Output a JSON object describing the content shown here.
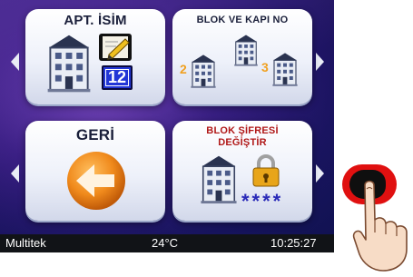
{
  "tiles": {
    "apt_name": {
      "title": "APT. İSİM",
      "badge_number": "12"
    },
    "block_door": {
      "title": "BLOK VE KAPI NO",
      "num_left": "2",
      "num_right": "3"
    },
    "back": {
      "title": "GERİ"
    },
    "block_password": {
      "title_line1": "BLOK ŞİFRESİ",
      "title_line2": "DEĞİŞTİR",
      "mask": "****"
    }
  },
  "status_bar": {
    "brand": "Multitek",
    "temperature": "24°C",
    "time": "10:25:27"
  },
  "icons": [
    "building-icon",
    "edit-pencil-icon",
    "number-badge-icon",
    "back-arrow-icon",
    "padlock-icon",
    "finger-pointer-icon",
    "reader-pad-icon"
  ],
  "colors": {
    "accent_blue": "#2236d6",
    "orange": "#f08a1c",
    "lock_gold": "#e8a51a",
    "pad_red": "#e01010"
  }
}
